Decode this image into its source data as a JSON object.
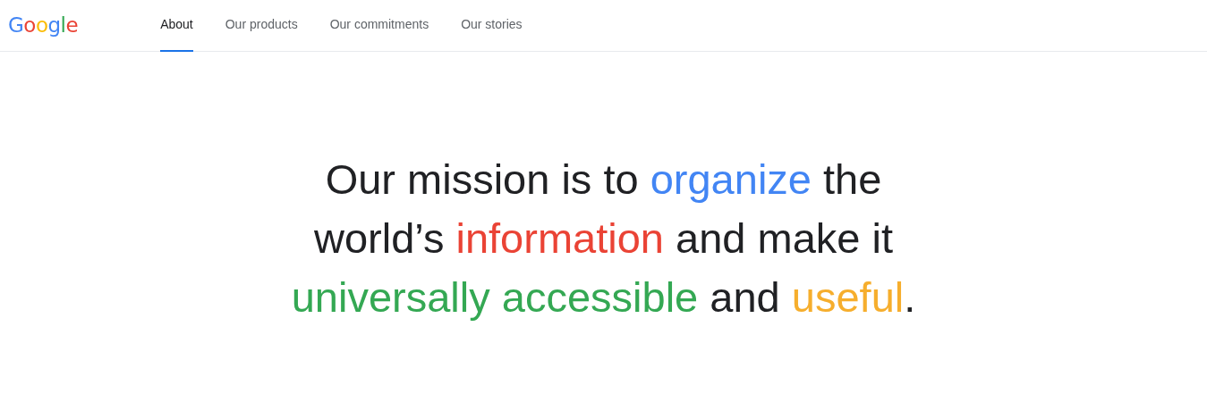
{
  "logo": {
    "letters": [
      {
        "text": "G",
        "color": "#4285f4"
      },
      {
        "text": "o",
        "color": "#ea4335"
      },
      {
        "text": "o",
        "color": "#fbbc05"
      },
      {
        "text": "g",
        "color": "#4285f4"
      },
      {
        "text": "l",
        "color": "#34a853"
      },
      {
        "text": "e",
        "color": "#ea4335"
      }
    ]
  },
  "nav": [
    {
      "label": "About",
      "selected": true
    },
    {
      "label": "Our products",
      "selected": false
    },
    {
      "label": "Our commitments",
      "selected": false
    },
    {
      "label": "Our stories",
      "selected": false
    }
  ],
  "mission": {
    "segments": [
      {
        "text": "Our mission is to ",
        "color": "#202124"
      },
      {
        "text": "organize",
        "color": "#4285f4"
      },
      {
        "text": " the world’s ",
        "color": "#202124"
      },
      {
        "text": "information",
        "color": "#ea4335"
      },
      {
        "text": " and make it ",
        "color": "#202124"
      },
      {
        "text": "universally accessible",
        "color": "#34a853"
      },
      {
        "text": " and ",
        "color": "#202124"
      },
      {
        "text": "useful",
        "color": "#f6ae2d"
      },
      {
        "text": ".",
        "color": "#202124"
      }
    ]
  }
}
